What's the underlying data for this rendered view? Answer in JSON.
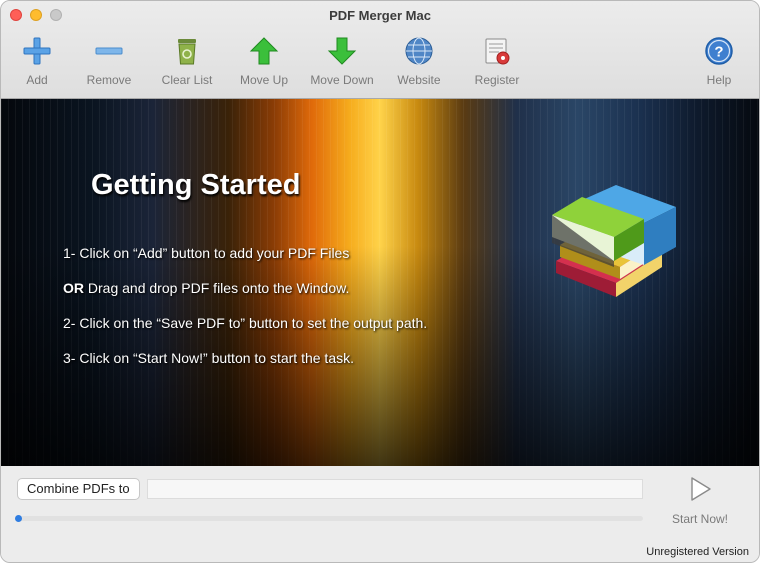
{
  "window": {
    "title": "PDF Merger Mac"
  },
  "toolbar": {
    "items": [
      {
        "label": "Add",
        "icon": "plus-icon"
      },
      {
        "label": "Remove",
        "icon": "minus-icon"
      },
      {
        "label": "Clear List",
        "icon": "recycle-bin-icon"
      },
      {
        "label": "Move Up",
        "icon": "arrow-up-icon"
      },
      {
        "label": "Move Down",
        "icon": "arrow-down-icon"
      },
      {
        "label": "Website",
        "icon": "globe-icon"
      },
      {
        "label": "Register",
        "icon": "register-icon"
      },
      {
        "label": "Help",
        "icon": "help-icon"
      }
    ]
  },
  "banner": {
    "title": "Getting Started",
    "steps": [
      "1- Click on “Add” button to add your PDF Files",
      "Drag and drop PDF files onto the Window.",
      "2- Click on the “Save PDF to” button to set the output path.",
      "3- Click on “Start Now!” button to start the task."
    ],
    "or_label": "OR",
    "illustration": "books-icon"
  },
  "bottom": {
    "combine_label": "Combine PDFs to",
    "output_path": "",
    "progress": 0,
    "start_label": "Start Now!",
    "status": "Unregistered Version"
  },
  "colors": {
    "accent": "#2f7de1",
    "close": "#ff5f57",
    "minimize": "#febc2e"
  }
}
